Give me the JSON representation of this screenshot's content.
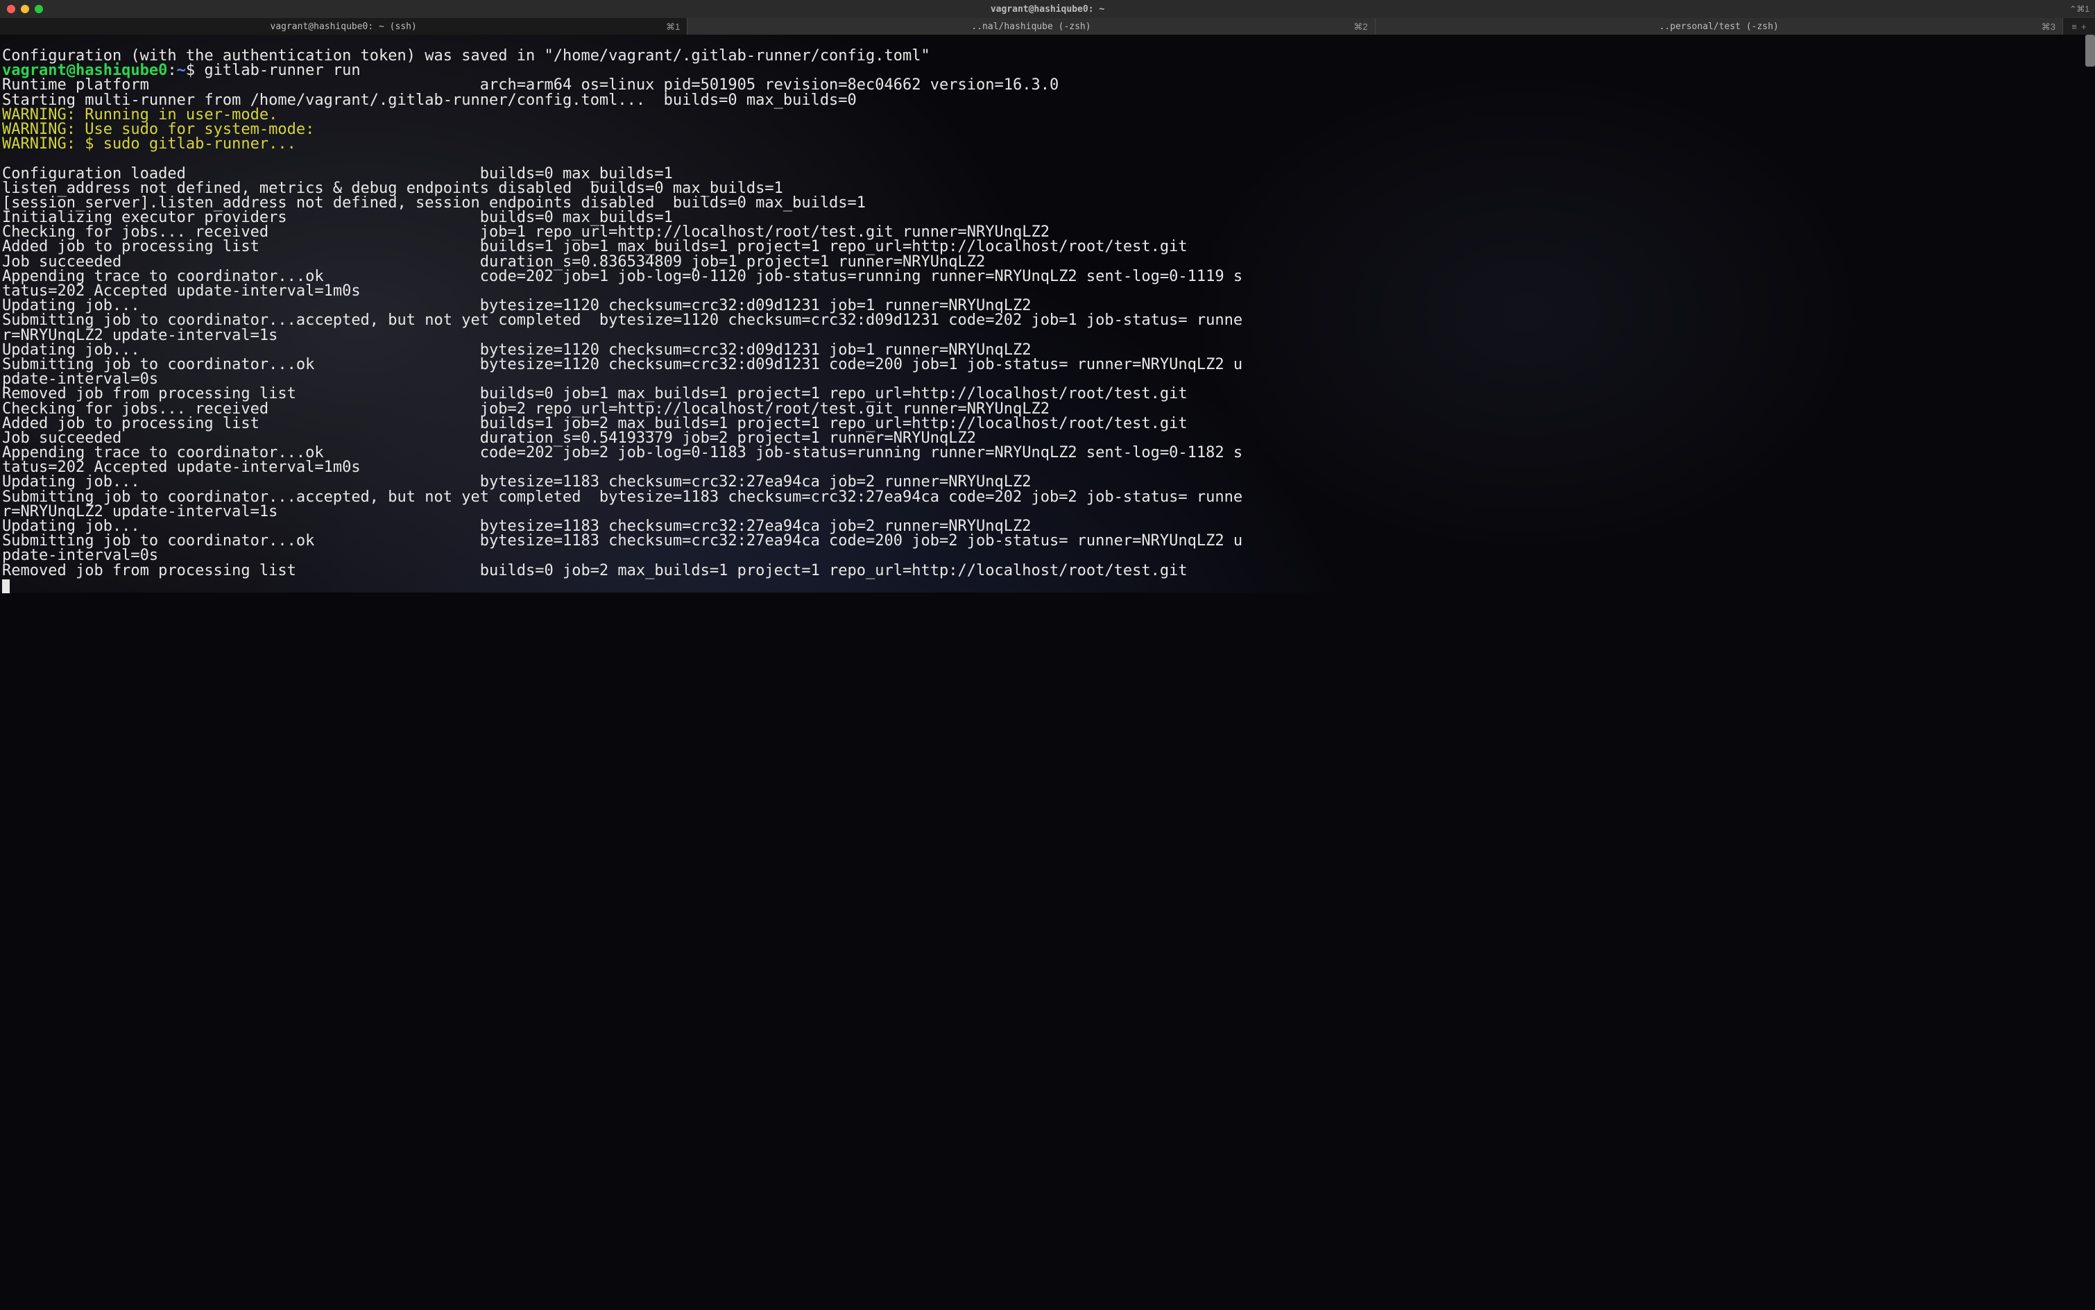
{
  "window": {
    "title": "vagrant@hashiqube0: ~",
    "broadcast_shortcut": "⌃⌘1"
  },
  "tabs": [
    {
      "label": "vagrant@hashiqube0: ~ (ssh)",
      "shortcut": "⌘1",
      "active": true
    },
    {
      "label": "..nal/hashiqube (-zsh)",
      "shortcut": "⌘2",
      "active": false
    },
    {
      "label": "..personal/test (-zsh)",
      "shortcut": "⌘3",
      "active": false
    }
  ],
  "tabbar_trail": {
    "menu": "≡",
    "add": "+"
  },
  "terminal": {
    "lines": [
      {
        "t": "plain",
        "text": "Configuration (with the authentication token) was saved in \"/home/vagrant/.gitlab-runner/config.toml\""
      },
      {
        "t": "prompt",
        "user": "vagrant@hashiqube0",
        "path": "~",
        "cmd": "gitlab-runner run"
      },
      {
        "t": "plain",
        "text": "Runtime platform                                    arch=arm64 os=linux pid=501905 revision=8ec04662 version=16.3.0"
      },
      {
        "t": "plain",
        "text": "Starting multi-runner from /home/vagrant/.gitlab-runner/config.toml...  builds=0 max_builds=0"
      },
      {
        "t": "warn",
        "text": "WARNING: Running in user-mode."
      },
      {
        "t": "warn",
        "text": "WARNING: Use sudo for system-mode:"
      },
      {
        "t": "warn",
        "text": "WARNING: $ sudo gitlab-runner..."
      },
      {
        "t": "plain",
        "text": " "
      },
      {
        "t": "plain",
        "text": "Configuration loaded                                builds=0 max_builds=1"
      },
      {
        "t": "plain",
        "text": "listen_address not defined, metrics & debug endpoints disabled  builds=0 max_builds=1"
      },
      {
        "t": "plain",
        "text": "[session_server].listen_address not defined, session endpoints disabled  builds=0 max_builds=1"
      },
      {
        "t": "plain",
        "text": "Initializing executor providers                     builds=0 max_builds=1"
      },
      {
        "t": "plain",
        "text": "Checking for jobs... received                       job=1 repo_url=http://localhost/root/test.git runner=NRYUnqLZ2"
      },
      {
        "t": "plain",
        "text": "Added job to processing list                        builds=1 job=1 max_builds=1 project=1 repo_url=http://localhost/root/test.git"
      },
      {
        "t": "plain",
        "text": "Job succeeded                                       duration_s=0.836534809 job=1 project=1 runner=NRYUnqLZ2"
      },
      {
        "t": "plain",
        "text": "Appending trace to coordinator...ok                 code=202 job=1 job-log=0-1120 job-status=running runner=NRYUnqLZ2 sent-log=0-1119 s"
      },
      {
        "t": "plain",
        "text": "tatus=202 Accepted update-interval=1m0s"
      },
      {
        "t": "plain",
        "text": "Updating job...                                     bytesize=1120 checksum=crc32:d09d1231 job=1 runner=NRYUnqLZ2"
      },
      {
        "t": "plain",
        "text": "Submitting job to coordinator...accepted, but not yet completed  bytesize=1120 checksum=crc32:d09d1231 code=202 job=1 job-status= runne"
      },
      {
        "t": "plain",
        "text": "r=NRYUnqLZ2 update-interval=1s"
      },
      {
        "t": "plain",
        "text": "Updating job...                                     bytesize=1120 checksum=crc32:d09d1231 job=1 runner=NRYUnqLZ2"
      },
      {
        "t": "plain",
        "text": "Submitting job to coordinator...ok                  bytesize=1120 checksum=crc32:d09d1231 code=200 job=1 job-status= runner=NRYUnqLZ2 u"
      },
      {
        "t": "plain",
        "text": "pdate-interval=0s"
      },
      {
        "t": "plain",
        "text": "Removed job from processing list                    builds=0 job=1 max_builds=1 project=1 repo_url=http://localhost/root/test.git"
      },
      {
        "t": "plain",
        "text": "Checking for jobs... received                       job=2 repo_url=http://localhost/root/test.git runner=NRYUnqLZ2"
      },
      {
        "t": "plain",
        "text": "Added job to processing list                        builds=1 job=2 max_builds=1 project=1 repo_url=http://localhost/root/test.git"
      },
      {
        "t": "plain",
        "text": "Job succeeded                                       duration_s=0.54193379 job=2 project=1 runner=NRYUnqLZ2"
      },
      {
        "t": "plain",
        "text": "Appending trace to coordinator...ok                 code=202 job=2 job-log=0-1183 job-status=running runner=NRYUnqLZ2 sent-log=0-1182 s"
      },
      {
        "t": "plain",
        "text": "tatus=202 Accepted update-interval=1m0s"
      },
      {
        "t": "plain",
        "text": "Updating job...                                     bytesize=1183 checksum=crc32:27ea94ca job=2 runner=NRYUnqLZ2"
      },
      {
        "t": "plain",
        "text": "Submitting job to coordinator...accepted, but not yet completed  bytesize=1183 checksum=crc32:27ea94ca code=202 job=2 job-status= runne"
      },
      {
        "t": "plain",
        "text": "r=NRYUnqLZ2 update-interval=1s"
      },
      {
        "t": "plain",
        "text": "Updating job...                                     bytesize=1183 checksum=crc32:27ea94ca job=2 runner=NRYUnqLZ2"
      },
      {
        "t": "plain",
        "text": "Submitting job to coordinator...ok                  bytesize=1183 checksum=crc32:27ea94ca code=200 job=2 job-status= runner=NRYUnqLZ2 u"
      },
      {
        "t": "plain",
        "text": "pdate-interval=0s"
      },
      {
        "t": "plain",
        "text": "Removed job from processing list                    builds=0 job=2 max_builds=1 project=1 repo_url=http://localhost/root/test.git"
      }
    ]
  }
}
